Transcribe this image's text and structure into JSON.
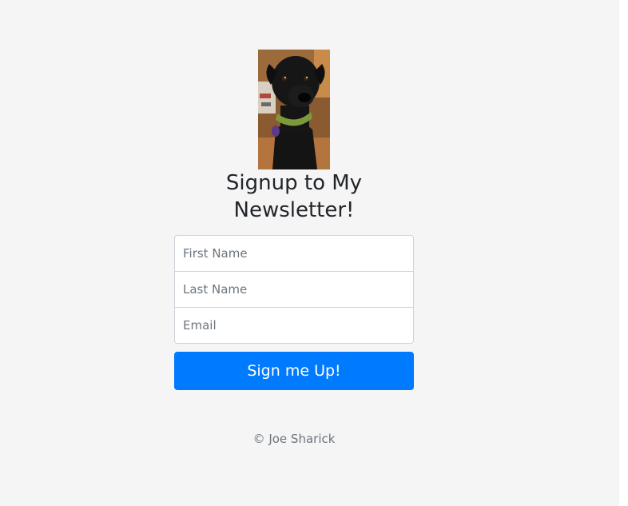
{
  "header": {
    "image_alt": "black dog photo",
    "title_line1": "Signup to My",
    "title_line2": "Newsletter!"
  },
  "form": {
    "first_name_placeholder": "First Name",
    "last_name_placeholder": "Last Name",
    "email_placeholder": "Email",
    "submit_label": "Sign me Up!"
  },
  "footer": {
    "copyright": "© Joe Sharick"
  },
  "colors": {
    "background": "#f5f5f5",
    "accent": "#007bff",
    "text": "#212529",
    "muted": "#6c757d"
  }
}
